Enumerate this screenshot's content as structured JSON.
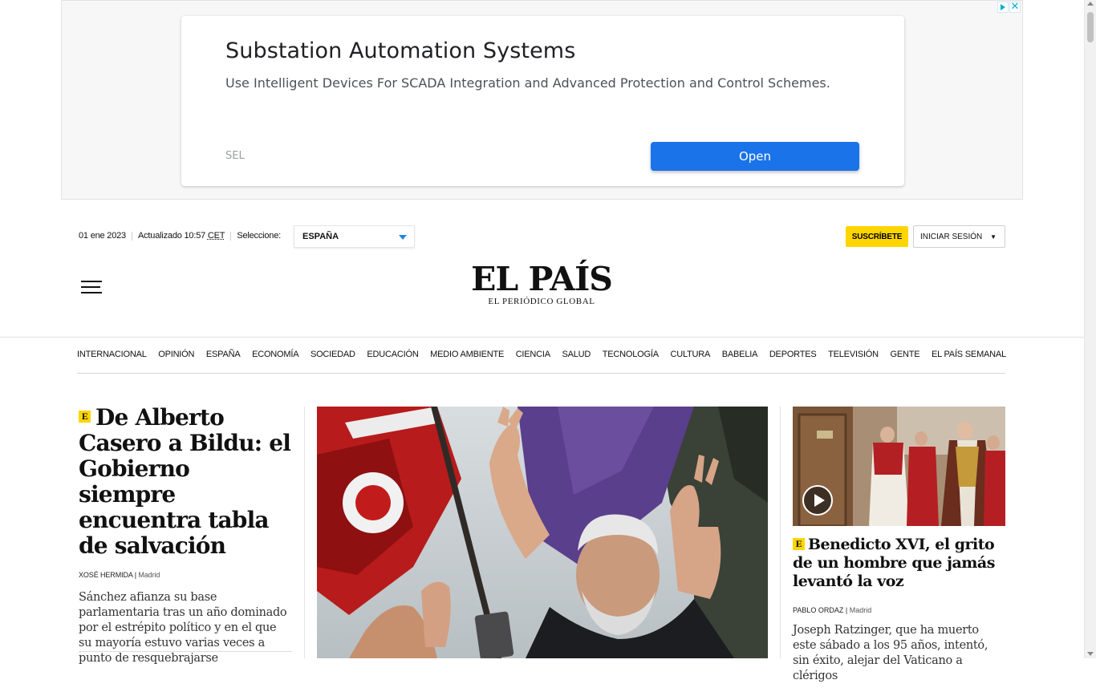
{
  "ad": {
    "title": "Substation Automation Systems",
    "description": "Use Intelligent Devices For SCADA Integration and Advanced Protection and Control Schemes.",
    "advertiser": "SEL",
    "cta": "Open",
    "close_glyph": "✕"
  },
  "header": {
    "date": "01 ene 2023",
    "updated": "Actualizado 10:57",
    "timezone": "CET",
    "select_label": "Seleccione:",
    "edition": "ESPAÑA",
    "subscribe": "SUSCRÍBETE",
    "login": "INICIAR SESIÓN",
    "login_arrow": "▼",
    "logo": "EL PAÍS",
    "tagline": "EL PERIÓDICO GLOBAL"
  },
  "nav": {
    "items": [
      {
        "label": "INTERNACIONAL"
      },
      {
        "label": "OPINIÓN"
      },
      {
        "label": "ESPAÑA"
      },
      {
        "label": "ECONOMÍA"
      },
      {
        "label": "SOCIEDAD"
      },
      {
        "label": "EDUCACIÓN"
      },
      {
        "label": "MEDIO AMBIENTE"
      },
      {
        "label": "CIENCIA"
      },
      {
        "label": "SALUD"
      },
      {
        "label": "TECNOLOGÍA"
      },
      {
        "label": "CULTURA"
      },
      {
        "label": "BABELIA"
      },
      {
        "label": "DEPORTES"
      },
      {
        "label": "TELEVISIÓN"
      },
      {
        "label": "GENTE"
      },
      {
        "label": "EL PAÍS SEMANAL"
      }
    ]
  },
  "lead": {
    "badge": "E",
    "title": "De Alberto Casero a Bildu: el Gobierno siempre encuentra tabla de salvación",
    "author": "XOSÉ HERMIDA",
    "location": "Madrid",
    "summary": "Sánchez afianza su base parlamentaria tras un año dominado por el estrépito político y en el que su mayoría estuvo varias veces a punto de resquebrajarse"
  },
  "side": {
    "badge": "E",
    "title": "Benedicto XVI, el grito de un hombre que jamás levantó la voz",
    "author": "PABLO ORDAZ",
    "location": "Madrid",
    "summary": "Joseph Ratzinger, que ha muerto este sábado a los 95 años, intentó, sin éxito, alejar del Vaticano a clérigos"
  },
  "colors": {
    "brand_yellow": "#ffd500",
    "ad_button": "#1a73e8",
    "edition_caret": "#1e88e5"
  }
}
